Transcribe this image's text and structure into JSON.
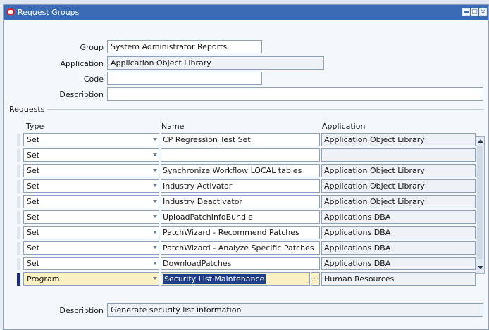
{
  "window": {
    "title": "Request Groups"
  },
  "form": {
    "group_label": "Group",
    "group_value": "System Administrator Reports",
    "application_label": "Application",
    "application_value": "Application Object Library",
    "code_label": "Code",
    "code_value": "",
    "description_label": "Description",
    "description_value": ""
  },
  "requests": {
    "section_label": "Requests",
    "columns": {
      "type": "Type",
      "name": "Name",
      "application": "Application"
    },
    "rows": [
      {
        "type": "Set",
        "name": "CP Regression Test Set",
        "application": "Application Object Library"
      },
      {
        "type": "Set",
        "name": "",
        "application": ""
      },
      {
        "type": "Set",
        "name": "Synchronize Workflow LOCAL tables",
        "application": "Application Object Library"
      },
      {
        "type": "Set",
        "name": "Industry Activator",
        "application": "Application Object Library"
      },
      {
        "type": "Set",
        "name": "Industry Deactivator",
        "application": "Application Object Library"
      },
      {
        "type": "Set",
        "name": "UploadPatchInfoBundle",
        "application": "Applications DBA"
      },
      {
        "type": "Set",
        "name": "PatchWizard - Recommend Patches",
        "application": "Applications DBA"
      },
      {
        "type": "Set",
        "name": "PatchWizard - Analyze Specific Patches",
        "application": "Applications DBA"
      },
      {
        "type": "Set",
        "name": "DownloadPatches",
        "application": "Applications DBA"
      },
      {
        "type": "Program",
        "name": "Security List Maintenance",
        "application": "Human Resources"
      }
    ],
    "lov_button": "...",
    "description_label": "Description",
    "description_value": "Generate security list information"
  }
}
